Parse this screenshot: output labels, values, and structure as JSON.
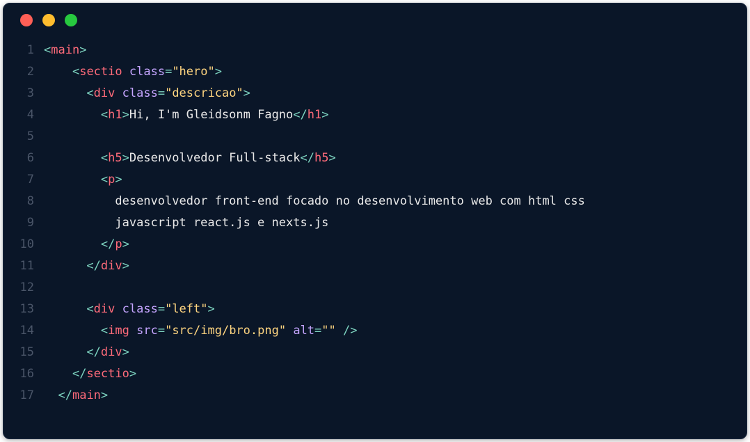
{
  "window": {
    "dots": [
      "red",
      "yellow",
      "green"
    ]
  },
  "gutter": [
    "1",
    "2",
    "3",
    "4",
    "5",
    "6",
    "7",
    "8",
    "9",
    "10",
    "11",
    "12",
    "13",
    "14",
    "15",
    "16",
    "17"
  ],
  "code": {
    "lines": [
      [
        {
          "t": "punc",
          "v": "<"
        },
        {
          "t": "tag",
          "v": "main"
        },
        {
          "t": "punc",
          "v": ">"
        }
      ],
      [
        {
          "t": "indent",
          "v": "    "
        },
        {
          "t": "punc",
          "v": "<"
        },
        {
          "t": "tag",
          "v": "sectio"
        },
        {
          "t": "sp",
          "v": " "
        },
        {
          "t": "attr",
          "v": "class"
        },
        {
          "t": "eq",
          "v": "="
        },
        {
          "t": "str",
          "v": "\"hero\""
        },
        {
          "t": "punc",
          "v": ">"
        }
      ],
      [
        {
          "t": "indent",
          "v": "      "
        },
        {
          "t": "punc",
          "v": "<"
        },
        {
          "t": "tag",
          "v": "div"
        },
        {
          "t": "sp",
          "v": " "
        },
        {
          "t": "attr",
          "v": "class"
        },
        {
          "t": "eq",
          "v": "="
        },
        {
          "t": "str",
          "v": "\"descricao\""
        },
        {
          "t": "punc",
          "v": ">"
        }
      ],
      [
        {
          "t": "indent",
          "v": "        "
        },
        {
          "t": "punc",
          "v": "<"
        },
        {
          "t": "tag",
          "v": "h1"
        },
        {
          "t": "punc",
          "v": ">"
        },
        {
          "t": "text",
          "v": "Hi, I'm Gleidsonm Fagno"
        },
        {
          "t": "punc",
          "v": "</"
        },
        {
          "t": "tag",
          "v": "h1"
        },
        {
          "t": "punc",
          "v": ">"
        }
      ],
      [
        {
          "t": "indent",
          "v": ""
        }
      ],
      [
        {
          "t": "indent",
          "v": "        "
        },
        {
          "t": "punc",
          "v": "<"
        },
        {
          "t": "tag",
          "v": "h5"
        },
        {
          "t": "punc",
          "v": ">"
        },
        {
          "t": "text",
          "v": "Desenvolvedor Full-stack"
        },
        {
          "t": "punc",
          "v": "</"
        },
        {
          "t": "tag",
          "v": "h5"
        },
        {
          "t": "punc",
          "v": ">"
        }
      ],
      [
        {
          "t": "indent",
          "v": "        "
        },
        {
          "t": "punc",
          "v": "<"
        },
        {
          "t": "tag",
          "v": "p"
        },
        {
          "t": "punc",
          "v": ">"
        }
      ],
      [
        {
          "t": "indent",
          "v": "          "
        },
        {
          "t": "text",
          "v": "desenvolvedor front-end focado no desenvolvimento web com html css"
        }
      ],
      [
        {
          "t": "indent",
          "v": "          "
        },
        {
          "t": "text",
          "v": "javascript react.js e nexts.js"
        }
      ],
      [
        {
          "t": "indent",
          "v": "        "
        },
        {
          "t": "punc",
          "v": "</"
        },
        {
          "t": "tag",
          "v": "p"
        },
        {
          "t": "punc",
          "v": ">"
        }
      ],
      [
        {
          "t": "indent",
          "v": "      "
        },
        {
          "t": "punc",
          "v": "</"
        },
        {
          "t": "tag",
          "v": "div"
        },
        {
          "t": "punc",
          "v": ">"
        }
      ],
      [
        {
          "t": "indent",
          "v": ""
        }
      ],
      [
        {
          "t": "indent",
          "v": "      "
        },
        {
          "t": "punc",
          "v": "<"
        },
        {
          "t": "tag",
          "v": "div"
        },
        {
          "t": "sp",
          "v": " "
        },
        {
          "t": "attr",
          "v": "class"
        },
        {
          "t": "eq",
          "v": "="
        },
        {
          "t": "str",
          "v": "\"left\""
        },
        {
          "t": "punc",
          "v": ">"
        }
      ],
      [
        {
          "t": "indent",
          "v": "        "
        },
        {
          "t": "punc",
          "v": "<"
        },
        {
          "t": "tag",
          "v": "img"
        },
        {
          "t": "sp",
          "v": " "
        },
        {
          "t": "attr",
          "v": "src"
        },
        {
          "t": "eq",
          "v": "="
        },
        {
          "t": "str",
          "v": "\"src/img/bro.png\""
        },
        {
          "t": "sp",
          "v": " "
        },
        {
          "t": "attr",
          "v": "alt"
        },
        {
          "t": "eq",
          "v": "="
        },
        {
          "t": "str",
          "v": "\"\""
        },
        {
          "t": "sp",
          "v": " "
        },
        {
          "t": "punc",
          "v": "/>"
        }
      ],
      [
        {
          "t": "indent",
          "v": "      "
        },
        {
          "t": "punc",
          "v": "</"
        },
        {
          "t": "tag",
          "v": "div"
        },
        {
          "t": "punc",
          "v": ">"
        }
      ],
      [
        {
          "t": "indent",
          "v": "    "
        },
        {
          "t": "punc",
          "v": "</"
        },
        {
          "t": "tag",
          "v": "sectio"
        },
        {
          "t": "punc",
          "v": ">"
        }
      ],
      [
        {
          "t": "indent",
          "v": "  "
        },
        {
          "t": "punc",
          "v": "</"
        },
        {
          "t": "tag",
          "v": "main"
        },
        {
          "t": "punc",
          "v": ">"
        }
      ]
    ]
  }
}
